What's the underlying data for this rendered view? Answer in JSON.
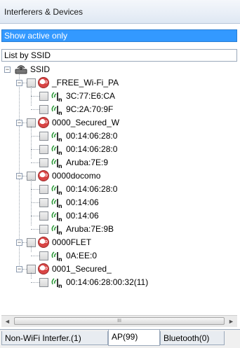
{
  "panel": {
    "title": "Interferers & Devices"
  },
  "filter": {
    "selected": "Show active only"
  },
  "list_by": {
    "label": "List by SSID"
  },
  "tree": {
    "root": {
      "label": "SSID"
    },
    "groups": [
      {
        "ssid": "_FREE_Wi-Fi_PA",
        "children": [
          "3C:77:E6:CA",
          "9C:2A:70:9F"
        ]
      },
      {
        "ssid": "0000_Secured_W",
        "children": [
          "00:14:06:28:0",
          "00:14:06:28:0",
          "Aruba:7E:9"
        ]
      },
      {
        "ssid": "0000docomo",
        "children": [
          "00:14:06:28:0",
          "00:14:06",
          "00:14:06",
          "Aruba:7E:9B"
        ]
      },
      {
        "ssid": "0000FLET",
        "children": [
          "0A:EE:0"
        ]
      },
      {
        "ssid": "0001_Secured_",
        "children": [
          "00:14:06:28:00:32(11)"
        ]
      }
    ]
  },
  "scrollbar": {
    "thumb_grip": "III",
    "left_arrow": "◄",
    "right_arrow": "►"
  },
  "tabs": [
    {
      "label": "Non-WiFi Interfer.(1)",
      "active": false
    },
    {
      "label": "AP(99)",
      "active": true
    },
    {
      "label": "Bluetooth(0)",
      "active": false
    }
  ],
  "colors": {
    "selection": "#3399ff",
    "ssid_icon": "#d94545",
    "ap_icon": "#2e9a3a"
  },
  "icons": {
    "ssid": "ssid-icon",
    "ap": "access-point-icon",
    "root": "network-root-icon"
  }
}
